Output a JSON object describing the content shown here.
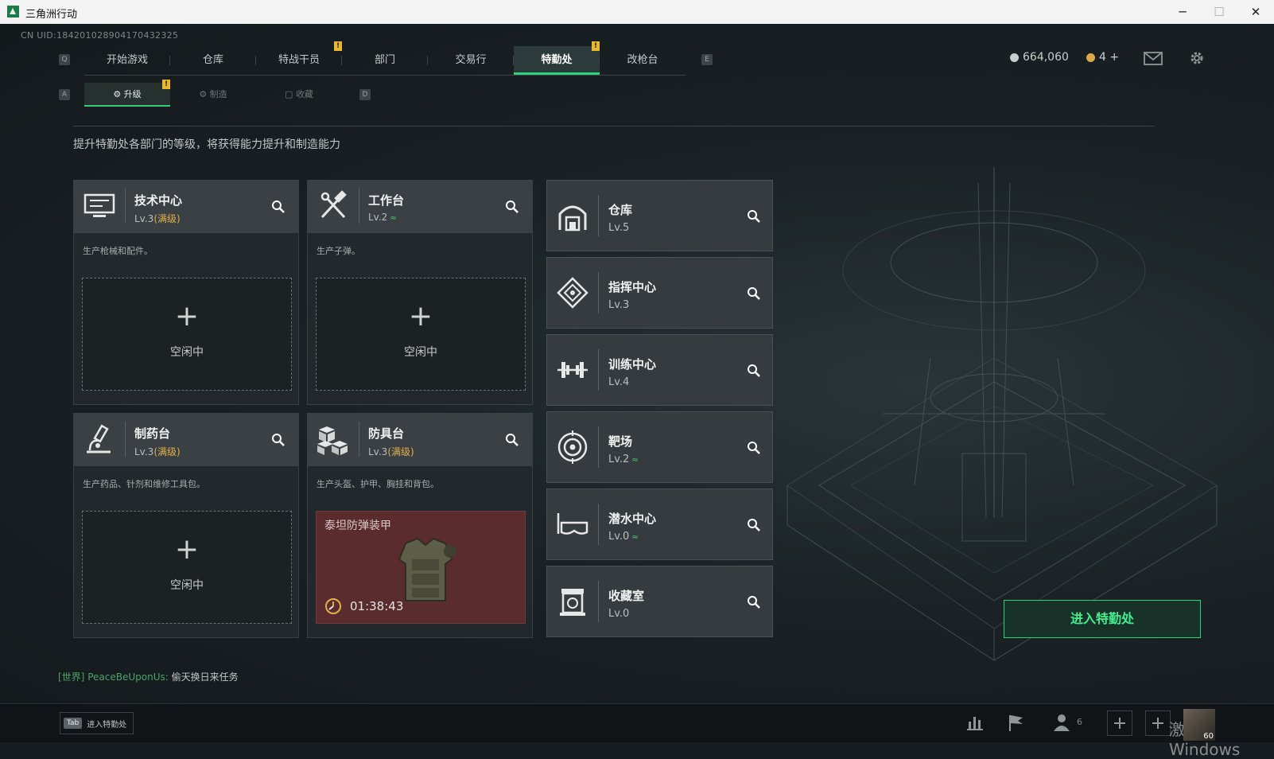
{
  "window": {
    "title": "三角洲行动",
    "minimize": "─",
    "maximize": "☐",
    "close": "✕"
  },
  "uid": "CN UID:184201028904170432325",
  "nav": {
    "key_left": "Q",
    "key_right": "E",
    "tabs": [
      {
        "label": "开始游戏"
      },
      {
        "label": "仓库"
      },
      {
        "label": "特战干员",
        "alert": "!"
      },
      {
        "label": "部门"
      },
      {
        "label": "交易行"
      },
      {
        "label": "特勤处",
        "alert": "!",
        "active": true
      },
      {
        "label": "改枪台"
      }
    ]
  },
  "currency": {
    "coins": "664,060",
    "tickets": "4 +"
  },
  "subnav": {
    "key_left": "A",
    "key_right": "D",
    "tabs": [
      {
        "label": "升级",
        "alert": "!",
        "active": true
      },
      {
        "label": "制造"
      },
      {
        "label": "收藏"
      }
    ]
  },
  "description": "提升特勤处各部门的等级，将获得能力提升和制造能力",
  "workbenches": [
    {
      "name": "技术中心",
      "level": "Lv.3",
      "max": "(满级)",
      "desc": "生产枪械和配件。",
      "slot_plus": "+",
      "slot_status": "空闲中",
      "icon": "computer-icon"
    },
    {
      "name": "工作台",
      "level": "Lv.2",
      "upgrade": "≈",
      "desc": "生产子弹。",
      "slot_plus": "+",
      "slot_status": "空闲中",
      "icon": "hammer-wrench-icon"
    },
    {
      "name": "制药台",
      "level": "Lv.3",
      "max": "(满级)",
      "desc": "生产药品、针剂和维修工具包。",
      "slot_plus": "+",
      "slot_status": "空闲中",
      "icon": "microscope-icon"
    },
    {
      "name": "防具台",
      "level": "Lv.3",
      "max": "(满级)",
      "desc": "生产头盔、护甲、胸挂和背包。",
      "crafting_item": "泰坦防弹装甲",
      "crafting_timer": "01:38:43",
      "icon": "cubes-icon"
    }
  ],
  "facilities": [
    {
      "name": "仓库",
      "level": "Lv.5",
      "icon": "warehouse-icon"
    },
    {
      "name": "指挥中心",
      "level": "Lv.3",
      "icon": "command-icon"
    },
    {
      "name": "训练中心",
      "level": "Lv.4",
      "icon": "dumbbell-icon"
    },
    {
      "name": "靶场",
      "level": "Lv.2",
      "upgrade": "≈",
      "icon": "target-icon"
    },
    {
      "name": "潜水中心",
      "level": "Lv.0",
      "upgrade": "≈",
      "icon": "goggles-icon"
    },
    {
      "name": "收藏室",
      "level": "Lv.0",
      "icon": "collection-icon"
    }
  ],
  "enter_button": "进入特勤处",
  "chat": {
    "channel": "[世界]",
    "user": "PeaceBeUponUs:",
    "message": "偷天换日来任务"
  },
  "bottom": {
    "tab_key": "Tab",
    "tab_label": "进入特勤处",
    "friends_count": "6",
    "watermark": "激活 Windows",
    "avatar_level": "60"
  },
  "colors": {
    "accent": "#2ed07a",
    "alert": "#e8b92a",
    "max_level": "#e0b04a",
    "crafting_bg": "#5a2c2e"
  }
}
